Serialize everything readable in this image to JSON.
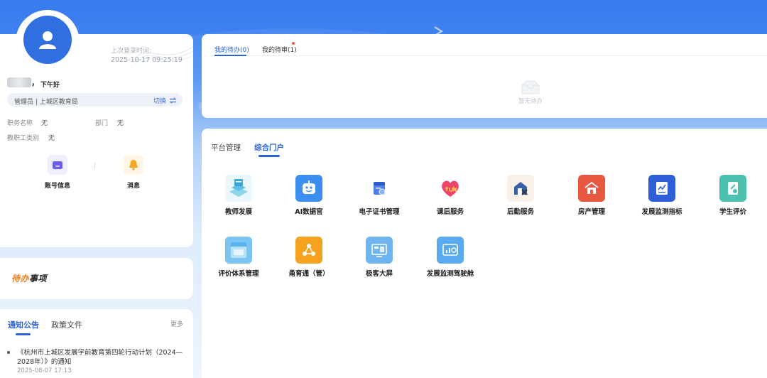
{
  "profile": {
    "last_login_label": "上次登录时间:",
    "last_login_time": "2025-10-17 09:25:19",
    "comma": "，",
    "greeting": "下午好",
    "role": "管理员 | 上城区教育局",
    "switch_label": "切换",
    "fields": [
      {
        "label": "职务名称",
        "value": "无"
      },
      {
        "label": "部门",
        "value": "无"
      },
      {
        "label": "教职工类别",
        "value": "无"
      }
    ],
    "quick_links": [
      {
        "label": "账号信息",
        "icon": "folder-icon",
        "color": "#6b5cf0"
      },
      {
        "label": "消息",
        "icon": "bell-icon",
        "color": "#f5a623"
      }
    ]
  },
  "todo": {
    "title_accent": "待办",
    "title_rest": "事项"
  },
  "notices": {
    "tabs": [
      "通知公告",
      "政策文件"
    ],
    "more": "更多",
    "items": [
      {
        "text": "《杭州市上城区发展学前教育第四轮行动计划（2024—2028年）》的通知",
        "date": "2025-08-07 17:13"
      }
    ]
  },
  "pending": {
    "tabs": [
      "我的待办(0)",
      "我的待审(1)"
    ],
    "empty_text": "暂无待办"
  },
  "portal": {
    "tabs": [
      "平台管理",
      "综合门户"
    ],
    "apps": [
      {
        "label": "教师发展",
        "icon": "teacher-development-icon"
      },
      {
        "label": "AI数据官",
        "icon": "robot-icon"
      },
      {
        "label": "电子证书管理",
        "icon": "certificate-icon"
      },
      {
        "label": "课后服务",
        "icon": "after-school-heart-icon"
      },
      {
        "label": "后勤服务",
        "icon": "logistics-icon"
      },
      {
        "label": "房产管理",
        "icon": "property-icon"
      },
      {
        "label": "发展监测指标",
        "icon": "monitor-chart-icon"
      },
      {
        "label": "学生评价",
        "icon": "student-evaluation-icon"
      },
      {
        "label": "评价体系管理",
        "icon": "evaluation-system-icon"
      },
      {
        "label": "甬育通（管）",
        "icon": "share-network-icon"
      },
      {
        "label": "极客大屏",
        "icon": "big-screen-icon"
      },
      {
        "label": "发展监测驾驶舱",
        "icon": "cockpit-icon"
      }
    ]
  },
  "colors": {
    "accent": "#2b63d6",
    "todo_accent": "#f07a1a"
  }
}
